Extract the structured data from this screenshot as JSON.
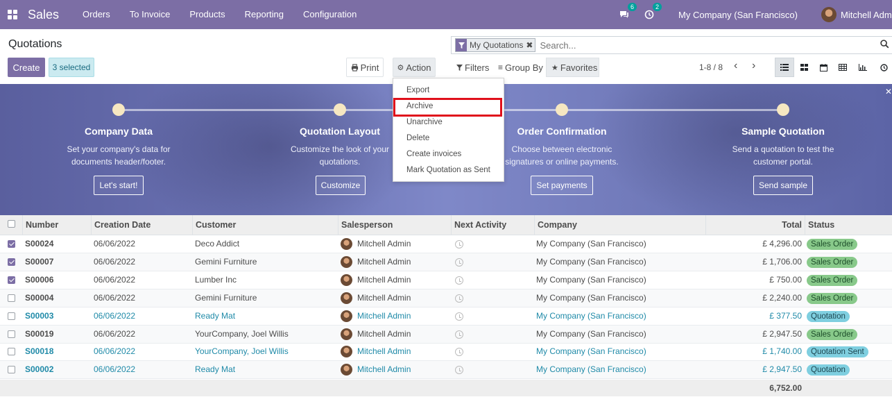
{
  "navbar": {
    "app_name": "Sales",
    "menu": [
      "Orders",
      "To Invoice",
      "Products",
      "Reporting",
      "Configuration"
    ],
    "messages_count": "6",
    "activities_count": "2",
    "company": "My Company (San Francisco)",
    "user": "Mitchell Admin"
  },
  "control": {
    "title": "Quotations",
    "create_label": "Create",
    "selected_label": "3 selected",
    "print_label": "Print",
    "action_label": "Action",
    "facet_label": "My Quotations",
    "search_placeholder": "Search...",
    "filters_label": "Filters",
    "groupby_label": "Group By",
    "favorites_label": "Favorites",
    "pager": "1-8 / 8"
  },
  "action_menu": [
    "Export",
    "Archive",
    "Unarchive",
    "Delete",
    "Create invoices",
    "Mark Quotation as Sent"
  ],
  "banner": {
    "steps": [
      {
        "title": "Company Data",
        "desc": "Set your company's data for documents header/footer.",
        "button": "Let's start!"
      },
      {
        "title": "Quotation Layout",
        "desc": "Customize the look of your quotations.",
        "button": "Customize"
      },
      {
        "title": "Order Confirmation",
        "desc": "Choose between electronic signatures or online payments.",
        "button": "Set payments"
      },
      {
        "title": "Sample Quotation",
        "desc": "Send a quotation to test the customer portal.",
        "button": "Send sample"
      }
    ]
  },
  "table": {
    "headers": [
      "Number",
      "Creation Date",
      "Customer",
      "Salesperson",
      "Next Activity",
      "Company",
      "Total",
      "Status"
    ],
    "rows": [
      {
        "number": "S00024",
        "date": "06/06/2022",
        "customer": "Deco Addict",
        "salesperson": "Mitchell Admin",
        "company": "My Company (San Francisco)",
        "total": "£ 4,296.00",
        "status": "Sales Order"
      },
      {
        "number": "S00007",
        "date": "06/06/2022",
        "customer": "Gemini Furniture",
        "salesperson": "Mitchell Admin",
        "company": "My Company (San Francisco)",
        "total": "£ 1,706.00",
        "status": "Sales Order"
      },
      {
        "number": "S00006",
        "date": "06/06/2022",
        "customer": "Lumber Inc",
        "salesperson": "Mitchell Admin",
        "company": "My Company (San Francisco)",
        "total": "£ 750.00",
        "status": "Sales Order"
      },
      {
        "number": "S00004",
        "date": "06/06/2022",
        "customer": "Gemini Furniture",
        "salesperson": "Mitchell Admin",
        "company": "My Company (San Francisco)",
        "total": "£ 2,240.00",
        "status": "Sales Order"
      },
      {
        "number": "S00003",
        "date": "06/06/2022",
        "customer": "Ready Mat",
        "salesperson": "Mitchell Admin",
        "company": "My Company (San Francisco)",
        "total": "£ 377.50",
        "status": "Quotation"
      },
      {
        "number": "S00019",
        "date": "06/06/2022",
        "customer": "YourCompany, Joel Willis",
        "salesperson": "Mitchell Admin",
        "company": "My Company (San Francisco)",
        "total": "£ 2,947.50",
        "status": "Sales Order"
      },
      {
        "number": "S00018",
        "date": "06/06/2022",
        "customer": "YourCompany, Joel Willis",
        "salesperson": "Mitchell Admin",
        "company": "My Company (San Francisco)",
        "total": "£ 1,740.00",
        "status": "Quotation Sent"
      },
      {
        "number": "S00002",
        "date": "06/06/2022",
        "customer": "Ready Mat",
        "salesperson": "Mitchell Admin",
        "company": "My Company (San Francisco)",
        "total": "£ 2,947.50",
        "status": "Quotation"
      }
    ],
    "sum_total": "6,752.00"
  },
  "colors": {
    "brand": "#7c6ea5",
    "highlight": "#e0101b",
    "sales_order": "#88c98a",
    "quotation": "#7fcfe0"
  }
}
